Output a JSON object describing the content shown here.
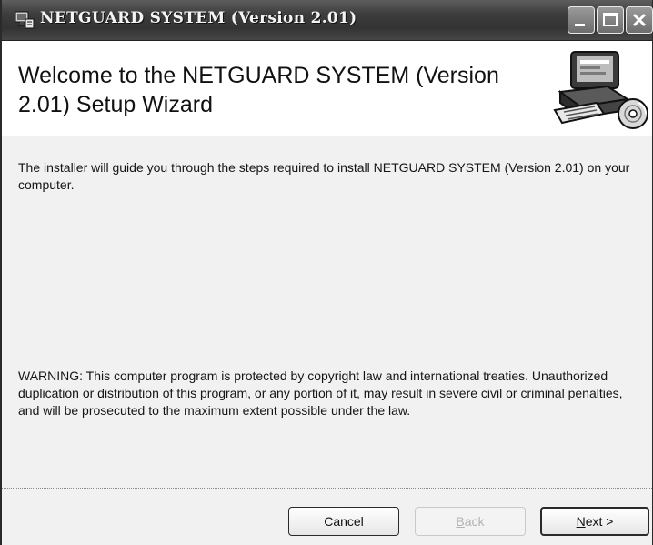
{
  "window": {
    "title": "NETGUARD SYSTEM (Version 2.01)",
    "controls": {
      "minimize": "minimize-icon",
      "maximize": "maximize-icon",
      "close": "close-icon"
    }
  },
  "header": {
    "heading": "Welcome to the NETGUARD SYSTEM (Version 2.01) Setup Wizard",
    "graphic": "computer-setup-icon"
  },
  "content": {
    "intro": "The installer will guide you through the steps required to install NETGUARD SYSTEM (Version 2.01) on your computer.",
    "warning": "WARNING: This computer program is protected by copyright law and international treaties. Unauthorized duplication or distribution of this program, or any portion of it, may result in severe civil or criminal penalties, and will be prosecuted to the maximum extent possible under the law."
  },
  "buttons": {
    "cancel": "Cancel",
    "back": {
      "mnemonic": "B",
      "rest": "ack",
      "enabled": false
    },
    "next": {
      "mnemonic": "N",
      "rest": "ext >",
      "enabled": true
    }
  }
}
